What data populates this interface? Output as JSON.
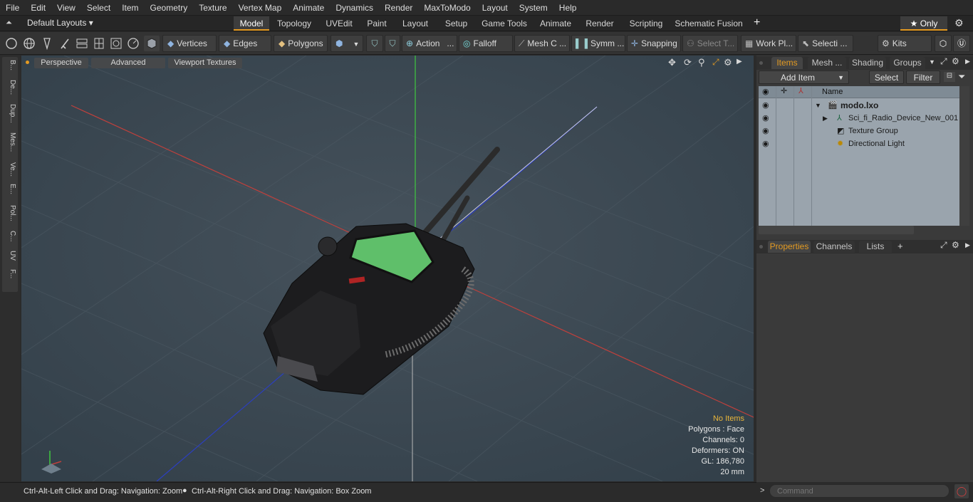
{
  "menu": [
    "File",
    "Edit",
    "View",
    "Select",
    "Item",
    "Geometry",
    "Texture",
    "Vertex Map",
    "Animate",
    "Dynamics",
    "Render",
    "MaxToModo",
    "Layout",
    "System",
    "Help"
  ],
  "layouts": {
    "label": "Default Layouts ▾"
  },
  "tabs": [
    "Model",
    "Topology",
    "UVEdit",
    "Paint",
    "Layout",
    "Setup",
    "Game Tools",
    "Animate",
    "Render",
    "Scripting",
    "Schematic Fusion"
  ],
  "active_tab": "Model",
  "tab_add": "+",
  "only_label": "★  Only",
  "toolbar": {
    "vertices": "Vertices",
    "edges": "Edges",
    "polygons": "Polygons",
    "action": "Action",
    "action_more": "...",
    "falloff": "Falloff",
    "mesh": "Mesh C ...",
    "symm": "Symm ...",
    "snapping": "Snapping",
    "select_t": "Select T...",
    "work_pl": "Work Pl...",
    "selecti": "Selecti ...",
    "kits": "Kits"
  },
  "left_tabs": [
    "B...",
    "De...",
    "Dup...",
    "Mes...",
    "Ve...",
    "E...",
    "Pol...",
    "C...",
    "UV",
    "F..."
  ],
  "viewport": {
    "perspective": "Perspective",
    "advanced": "Advanced",
    "textures": "Viewport Textures",
    "stats": {
      "no_items": "No Items",
      "polygons": "Polygons : Face",
      "channels": "Channels: 0",
      "deformers": "Deformers: ON",
      "gl": "GL: 186,780",
      "scale": "20 mm"
    },
    "accent": "#e39a22",
    "screen_color": "#5fbf6a"
  },
  "status": {
    "left": "Ctrl-Alt-Left Click and Drag: Navigation: Zoom",
    "right": "Ctrl-Alt-Right Click and Drag: Navigation: Box Zoom"
  },
  "items_panel": {
    "tabs": [
      "Items",
      "Mesh ...",
      "Shading",
      "Groups"
    ],
    "add_item": "Add Item",
    "select": "Select",
    "filter": "Filter",
    "col_name": "Name",
    "rows": [
      {
        "name": "modo.lxo"
      },
      {
        "name": "Sci_fi_Radio_Device_New_001"
      },
      {
        "name": "Texture Group"
      },
      {
        "name": "Directional Light"
      }
    ]
  },
  "props_panel": {
    "tabs": [
      "Properties",
      "Channels",
      "Lists"
    ],
    "add": "+"
  },
  "command": {
    "placeholder": "Command",
    "prompt": ">"
  }
}
